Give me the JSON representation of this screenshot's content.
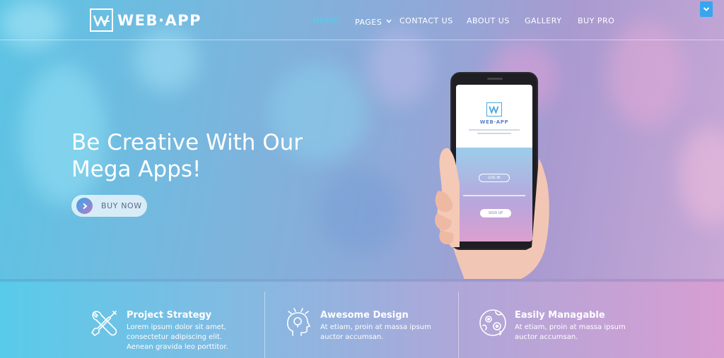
{
  "brand": {
    "name": "WEB·APP"
  },
  "nav": {
    "items": [
      {
        "label": "HOME",
        "active": true
      },
      {
        "label": "PAGES",
        "has_dropdown": true
      },
      {
        "label": "CONTACT US"
      },
      {
        "label": "ABOUT US"
      },
      {
        "label": "GALLERY"
      },
      {
        "label": "BUY PRO"
      }
    ],
    "toggle_icon": "chevron-down-icon"
  },
  "hero": {
    "headline_line1": "Be Creative With Our",
    "headline_line2": "Mega Apps!",
    "cta_label": "BUY NOW",
    "cta_icon": "chevron-right-icon"
  },
  "phone": {
    "app_name": "WEB·APP",
    "login_label": "LOG IN",
    "signup_label": "SIGN UP"
  },
  "features": [
    {
      "icon": "tools-icon",
      "title": "Project Strategy",
      "desc_line1": "Lorem ipsum dolor sit amet,",
      "desc_line2": "consectetur adipiscing elit.",
      "desc_line3": "Aenean gravida leo porttitor."
    },
    {
      "icon": "head-idea-icon",
      "title": "Awesome Design",
      "desc_line1": "At etiam, proin at massa ipsum",
      "desc_line2": "auctor accumsan."
    },
    {
      "icon": "globe-gear-icon",
      "title": "Easily Managable",
      "desc_line1": "At etiam, proin at massa ipsum",
      "desc_line2": "auctor accumsan."
    }
  ],
  "colors": {
    "accent_active_nav": "#4fd0ee",
    "toggle_button": "#37a6ee"
  }
}
